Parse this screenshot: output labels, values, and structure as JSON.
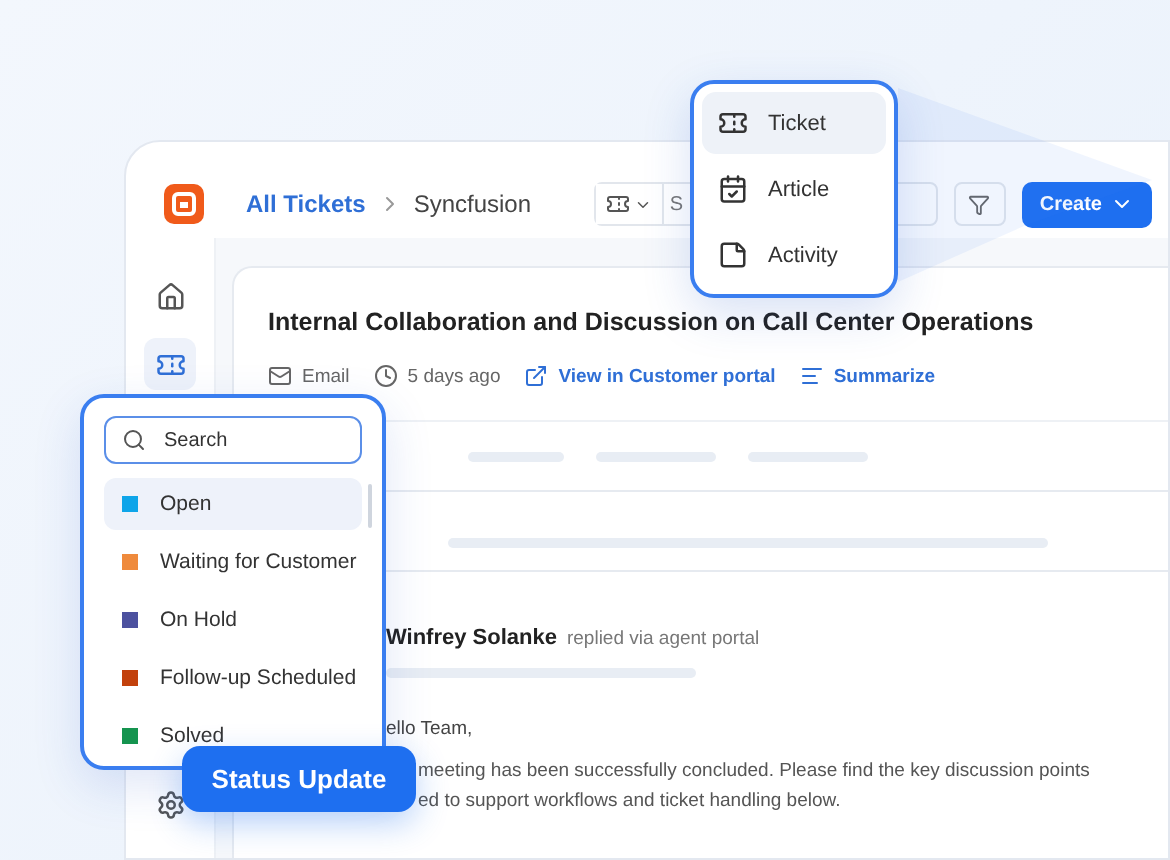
{
  "header": {
    "breadcrumb": [
      {
        "label": "All Tickets",
        "kind": "link"
      },
      {
        "label": "Syncfusion",
        "kind": "current"
      }
    ],
    "search": {
      "value": "S"
    },
    "create_button": "Create"
  },
  "sidebar": {
    "items": [
      {
        "kind": "home",
        "selected": false
      },
      {
        "kind": "ticket",
        "selected": true
      },
      {
        "kind": "settings",
        "selected": false
      }
    ]
  },
  "ticket": {
    "title": "Internal Collaboration and Discussion on Call Center Operations",
    "meta": [
      {
        "kind": "channel",
        "label": "Email"
      },
      {
        "kind": "time",
        "label": "5 days ago"
      },
      {
        "kind": "link",
        "label": "View in Customer portal"
      },
      {
        "kind": "summarize",
        "label": "Summarize"
      }
    ],
    "reply": {
      "author": "Winfrey Solanke",
      "action": "replied via agent portal",
      "greeting": "ello Team,",
      "body_lines": [
        "meeting has been successfully concluded. Please find the key discussion points",
        "ed to support workflows and ticket handling below."
      ]
    }
  },
  "create_menu": {
    "items": [
      {
        "label": "Ticket",
        "kind": "ticket",
        "selected": true
      },
      {
        "label": "Article",
        "kind": "article",
        "selected": false
      },
      {
        "label": "Activity",
        "kind": "activity",
        "selected": false
      }
    ]
  },
  "status_dropdown": {
    "search_placeholder": "Search",
    "options": [
      {
        "label": "Open",
        "color": "#0ea5e9",
        "selected": true
      },
      {
        "label": "Waiting for Customer",
        "color": "#ef8a3c",
        "selected": false
      },
      {
        "label": "On Hold",
        "color": "#4c519f",
        "selected": false
      },
      {
        "label": "Follow-up Scheduled",
        "color": "#c2410c",
        "selected": false
      },
      {
        "label": "Solved",
        "color": "#15944f",
        "selected": false
      }
    ]
  },
  "status_badge": "Status Update"
}
